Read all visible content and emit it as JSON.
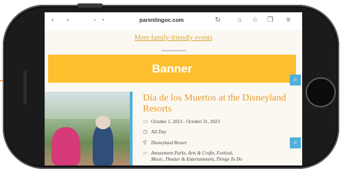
{
  "browser": {
    "url": "parentingoc.com"
  },
  "page": {
    "more_link": "More family-friendly events",
    "banner": "Banner",
    "event": {
      "title": "Día de los Muertos at the Disneyland Resorts",
      "dates": "October 1, 2023 - October 31, 2023",
      "time": "All Day",
      "location": "Disneyland Resort",
      "categories_line1": "Amusement Parks, Arts & Crafts, Festival,",
      "categories_line2": "Music, Theater & Entertainment, Things To Do"
    }
  },
  "colors": {
    "banner": "#fdbf2d",
    "accent_blue": "#4fb0d9",
    "title_orange": "#e99b2e"
  }
}
